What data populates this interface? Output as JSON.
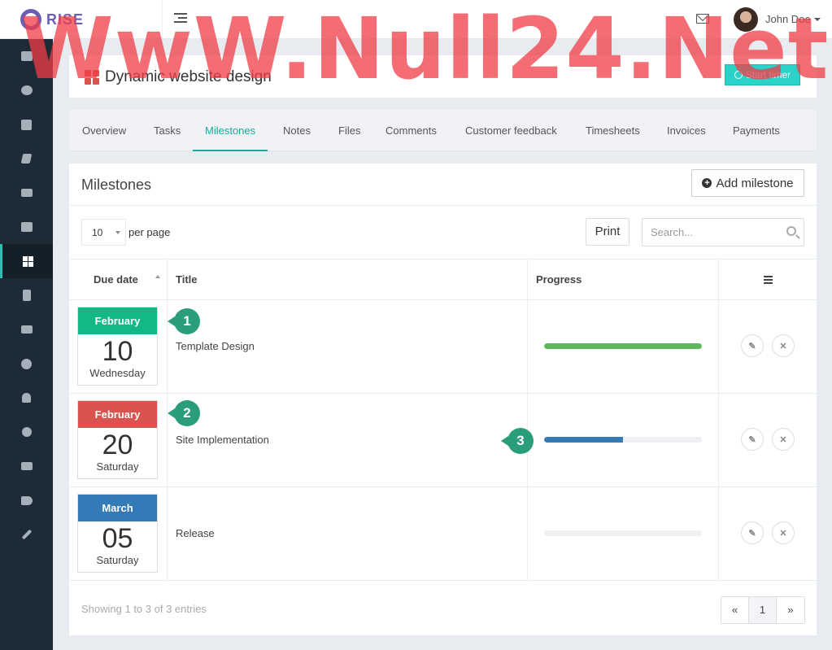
{
  "app": {
    "logo_text": "RISE"
  },
  "header": {
    "user_name": "John Doe"
  },
  "watermark": "WwW.Null24.Net",
  "sidebar": {
    "items": [
      {
        "name": "dashboard",
        "icon": "monitor-icon"
      },
      {
        "name": "messages",
        "icon": "chat-icon"
      },
      {
        "name": "events",
        "icon": "calendar-icon"
      },
      {
        "name": "notes",
        "icon": "book-icon"
      },
      {
        "name": "email",
        "icon": "envelope-icon"
      },
      {
        "name": "clients",
        "icon": "briefcase-icon"
      },
      {
        "name": "projects",
        "icon": "grid-icon",
        "active": true
      },
      {
        "name": "invoices",
        "icon": "file-icon"
      },
      {
        "name": "payments",
        "icon": "money-icon"
      },
      {
        "name": "support",
        "icon": "lifebuoy-icon"
      },
      {
        "name": "team",
        "icon": "user-icon"
      },
      {
        "name": "timesheets",
        "icon": "clock-icon"
      },
      {
        "name": "leave",
        "icon": "sign-out-icon"
      },
      {
        "name": "announcements",
        "icon": "megaphone-icon"
      },
      {
        "name": "settings",
        "icon": "wrench-icon"
      }
    ]
  },
  "project": {
    "title": "Dynamic website design",
    "start_timer_label": "Start timer"
  },
  "tabs": [
    {
      "label": "Overview"
    },
    {
      "label": "Tasks"
    },
    {
      "label": "Milestones",
      "active": true
    },
    {
      "label": "Notes"
    },
    {
      "label": "Files"
    },
    {
      "label": "Comments"
    },
    {
      "label": "Customer feedback"
    },
    {
      "label": "Timesheets"
    },
    {
      "label": "Invoices"
    },
    {
      "label": "Payments"
    }
  ],
  "milestones": {
    "title": "Milestones",
    "add_label": "Add milestone",
    "per_page_value": "10",
    "per_page_label": "per page",
    "print_label": "Print",
    "search_placeholder": "Search...",
    "columns": {
      "due_date": "Due date",
      "title": "Title",
      "progress": "Progress"
    },
    "rows": [
      {
        "month": "February",
        "day": "10",
        "weekday": "Wednesday",
        "title": "Template Design",
        "progress": 1.0,
        "month_color": "#12b886",
        "bar_color": "#5cb85c"
      },
      {
        "month": "February",
        "day": "20",
        "weekday": "Saturday",
        "title": "Site Implementation",
        "progress": 0.5,
        "month_color": "#d9534f",
        "bar_color": "#337ab7"
      },
      {
        "month": "March",
        "day": "05",
        "weekday": "Saturday",
        "title": "Release",
        "progress": 0.0,
        "month_color": "#337ab7",
        "bar_color": "#337ab7"
      }
    ],
    "showing_text": "Showing 1 to 3 of 3 entries",
    "pagination": {
      "prev": "«",
      "current": "1",
      "next": "»"
    }
  },
  "callouts": [
    "1",
    "2",
    "3"
  ],
  "colors": {
    "accent": "#1aa99b",
    "sidebar_bg": "#1c2b36",
    "callout": "#2a9d7a"
  }
}
